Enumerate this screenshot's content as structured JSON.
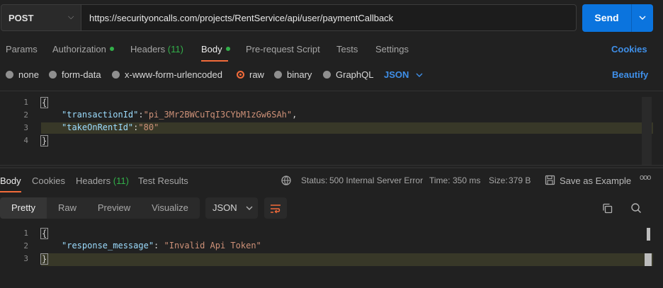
{
  "request": {
    "method": "POST",
    "url": "https://securityoncalls.com/projects/RentService/api/user/paymentCallback",
    "send_label": "Send"
  },
  "request_tabs": {
    "params": "Params",
    "authorization": "Authorization",
    "headers": "Headers",
    "headers_count": "(11)",
    "body": "Body",
    "pre_request": "Pre-request Script",
    "tests": "Tests",
    "settings": "Settings",
    "cookies": "Cookies"
  },
  "body_types": {
    "none": "none",
    "form_data": "form-data",
    "urlencoded": "x-www-form-urlencoded",
    "raw": "raw",
    "binary": "binary",
    "graphql": "GraphQL",
    "format": "JSON",
    "beautify": "Beautify"
  },
  "request_body": {
    "line_numbers": [
      "1",
      "2",
      "3",
      "4"
    ],
    "open": "{",
    "key1": "\"transactionId\"",
    "colon1": ":",
    "val1": "\"pi_3Mr2BWCuTqI3CYbM1zGw6SAh\"",
    "comma1": ",",
    "key2": "\"takeOnRentId\"",
    "colon2": ":",
    "val2": "\"80\"",
    "close": "}"
  },
  "response_tabs": {
    "body": "Body",
    "cookies": "Cookies",
    "headers": "Headers",
    "headers_count": "(11)",
    "test_results": "Test Results"
  },
  "response_status": {
    "status_label": "Status:",
    "status_value": "500 Internal Server Error",
    "time_label": "Time:",
    "time_value": "350 ms",
    "size_label": "Size:",
    "size_value": "379 B",
    "save_example": "Save as Example",
    "more": "ooo"
  },
  "response_view": {
    "pretty": "Pretty",
    "raw": "Raw",
    "preview": "Preview",
    "visualize": "Visualize",
    "format": "JSON"
  },
  "response_body": {
    "line_numbers": [
      "1",
      "2",
      "3"
    ],
    "open": "{",
    "key": "\"response_message\"",
    "colon": ": ",
    "value": "\"Invalid Api Token\"",
    "close": "}"
  },
  "colors": {
    "accent_blue": "#0b74de",
    "status_green": "#32b049",
    "radio_selected": "#f26b3a"
  }
}
